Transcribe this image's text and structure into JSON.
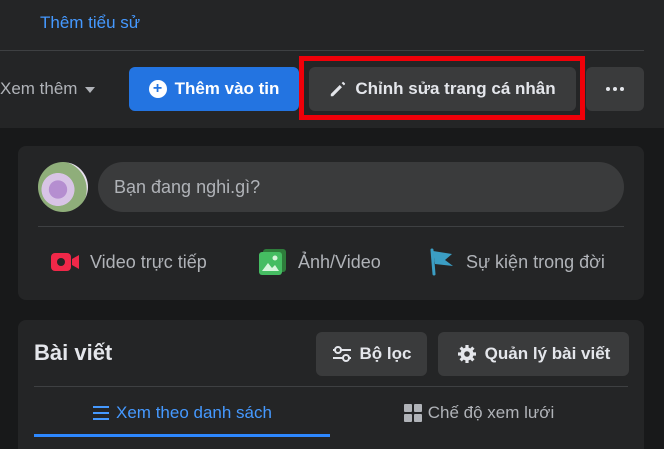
{
  "profile": {
    "bio_link": "Thêm tiểu sử",
    "see_more": "Xem thêm",
    "add_story": "Thêm vào tin",
    "edit_profile": "Chỉnh sửa trang cá nhân",
    "accent_color": "#2374e1",
    "highlight_color": "#f00009"
  },
  "composer": {
    "placeholder": "Bạn đang nghi.gì?",
    "actions": [
      {
        "label": "Video trực tiếp",
        "icon": "live-video-icon",
        "color": "#f02849"
      },
      {
        "label": "Ảnh/Video",
        "icon": "photo-video-icon",
        "color": "#45bd62"
      },
      {
        "label": "Sự kiện trong đời",
        "icon": "flag-icon",
        "color": "#3b9ec4"
      }
    ]
  },
  "posts": {
    "title": "Bài viết",
    "filter_label": "Bộ lọc",
    "manage_label": "Quản lý bài viết",
    "tabs": [
      {
        "label": "Xem theo danh sách",
        "icon": "list-icon",
        "active": true
      },
      {
        "label": "Chế độ xem lưới",
        "icon": "grid-icon",
        "active": false
      }
    ]
  }
}
